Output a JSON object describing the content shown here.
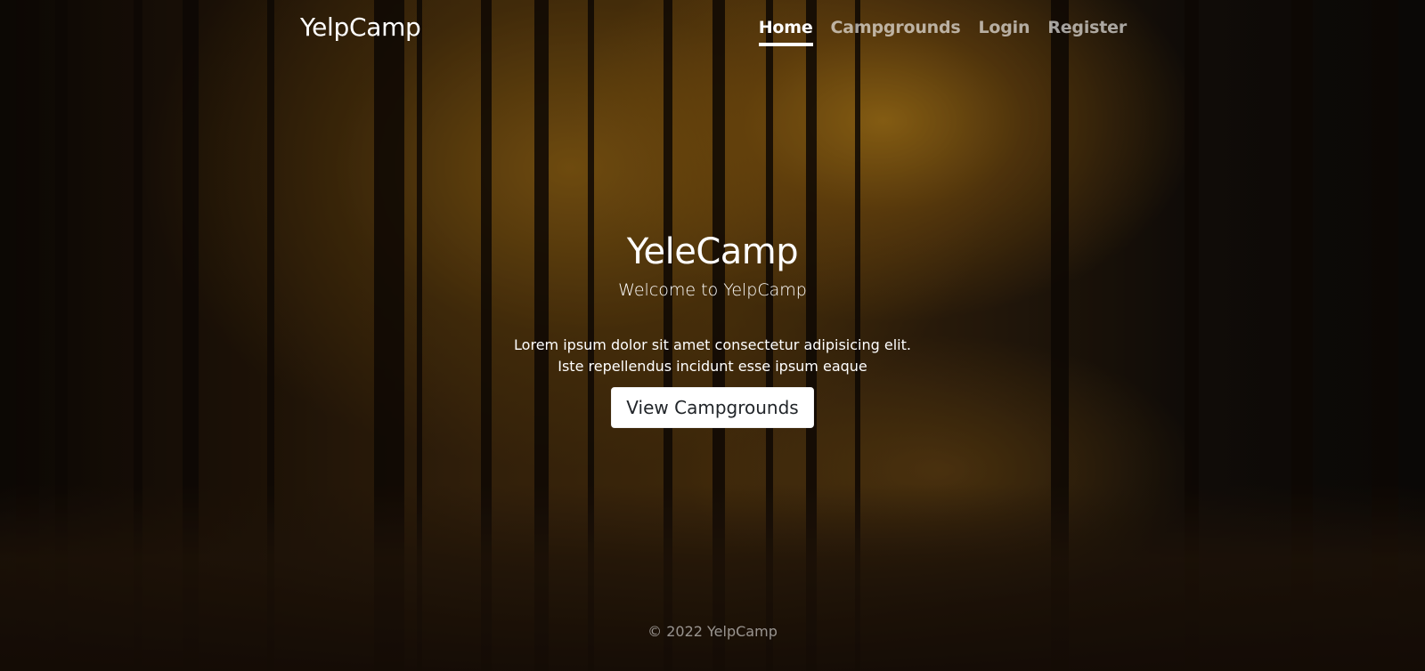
{
  "navbar": {
    "brand": "YelpCamp",
    "links": [
      {
        "label": "Home",
        "active": true
      },
      {
        "label": "Campgrounds",
        "active": false
      },
      {
        "label": "Login",
        "active": false
      },
      {
        "label": "Register",
        "active": false
      }
    ]
  },
  "hero": {
    "title": "YeleCamp",
    "subtitle": "Welcome to YelpCamp",
    "text_line1": "Lorem ipsum dolor sit amet consectetur adipisicing elit.",
    "text_line2": "Iste repellendus incidunt esse ipsum eaque",
    "button_label": "View Campgrounds"
  },
  "footer": {
    "text": "© 2022 YelpCamp"
  },
  "colors": {
    "text": "#ffffff",
    "button_bg": "#ffffff",
    "button_text": "#212529"
  }
}
